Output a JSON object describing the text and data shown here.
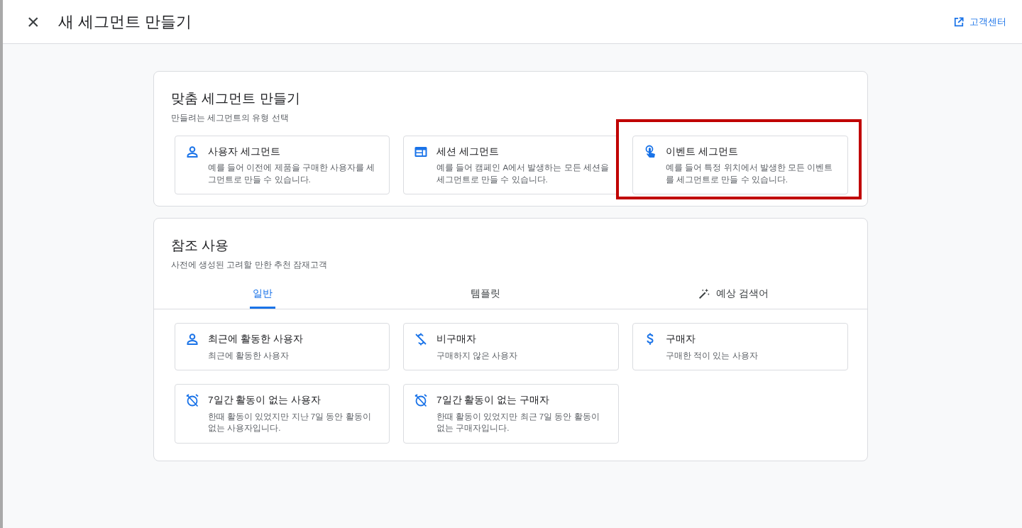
{
  "header": {
    "close": "×",
    "title": "새 세그먼트 만들기",
    "help_link": "고객센터"
  },
  "custom_panel": {
    "title": "맞춤 세그먼트 만들기",
    "subtitle": "만들려는 세그먼트의 유형 선택",
    "cards": [
      {
        "kind": "user",
        "title": "사용자 세그먼트",
        "description": "예를 들어 이전에 제품을 구매한 사용자를 세그먼트로 만들 수 있습니다.",
        "highlighted": false
      },
      {
        "kind": "session",
        "title": "세션 세그먼트",
        "description": "예를 들어 캠페인 A에서 발생하는 모든 세션을 세그먼트로 만들 수 있습니다.",
        "highlighted": false
      },
      {
        "kind": "event",
        "title": "이벤트 세그먼트",
        "description": "예를 들어 특정 위치에서 발생한 모든 이벤트를 세그먼트로 만들 수 있습니다.",
        "highlighted": true
      }
    ]
  },
  "reference_panel": {
    "title": "참조 사용",
    "subtitle": "사전에 생성된 고려할 만한 추천 잠재고객",
    "tabs": [
      {
        "label": "일반",
        "selected": true,
        "kind": "plain"
      },
      {
        "label": "템플릿",
        "selected": false,
        "kind": "plain"
      },
      {
        "label": "예상 검색어",
        "selected": false,
        "kind": "wand"
      }
    ],
    "cards": [
      {
        "kind": "user",
        "title": "최근에 활동한 사용자",
        "description": "최근에 활동한 사용자"
      },
      {
        "kind": "no-dollar",
        "title": "비구매자",
        "description": "구매하지 않은 사용자"
      },
      {
        "kind": "dollar",
        "title": "구매자",
        "description": "구매한 적이 있는 사용자"
      },
      {
        "kind": "alarm-off",
        "title": "7일간 활동이 없는 사용자",
        "description": "한때 활동이 있었지만 지난 7일 동안 활동이 없는 사용자입니다."
      },
      {
        "kind": "alarm-off",
        "title": "7일간 활동이 없는 구매자",
        "description": "한때 활동이 있었지만 최근 7일 동안 활동이 없는 구매자입니다."
      }
    ]
  }
}
